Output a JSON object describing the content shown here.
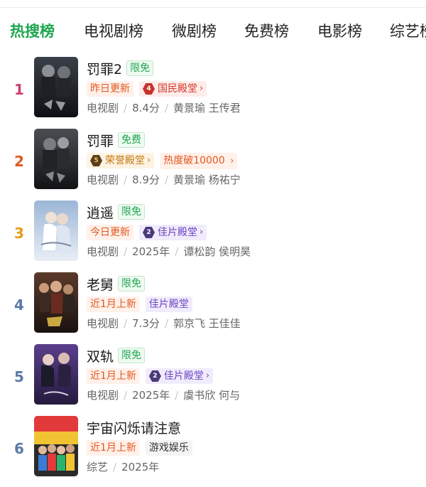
{
  "tabs": [
    {
      "label": "热搜榜",
      "active": true
    },
    {
      "label": "电视剧榜",
      "active": false
    },
    {
      "label": "微剧榜",
      "active": false
    },
    {
      "label": "免费榜",
      "active": false
    },
    {
      "label": "电影榜",
      "active": false
    },
    {
      "label": "综艺榜",
      "active": false
    }
  ],
  "colors": {
    "accent": "#1ea650",
    "rank1": "#d23c6b",
    "rank2": "#e2571f",
    "rank3": "#e99a1a",
    "rank_other": "#5a7aa6"
  },
  "items": [
    {
      "rank": "1",
      "title": "罚罪2",
      "free_badge": "限免",
      "update": "昨日更新",
      "hall_icon": "4",
      "hall": "国民殿堂",
      "hall_chevron": "›",
      "genre": "电视剧",
      "score_or_year": "8.4分",
      "cast": "黄景瑜 王传君"
    },
    {
      "rank": "2",
      "title": "罚罪",
      "free_badge": "免费",
      "hall_icon": "5",
      "hall": "荣誉殿堂",
      "hall_chevron": "›",
      "heat": "热度破10000",
      "heat_chevron": "›",
      "genre": "电视剧",
      "score_or_year": "8.9分",
      "cast": "黄景瑜 杨祐宁"
    },
    {
      "rank": "3",
      "title": "逍遥",
      "free_badge": "限免",
      "update": "今日更新",
      "hall_icon": "2",
      "hall": "佳片殿堂",
      "hall_chevron": "›",
      "genre": "电视剧",
      "score_or_year": "2025年",
      "cast": "谭松韵 侯明昊"
    },
    {
      "rank": "4",
      "title": "老舅",
      "free_badge": "限免",
      "update": "近1月上新",
      "hall": "佳片殿堂",
      "genre": "电视剧",
      "score_or_year": "7.3分",
      "cast": "郭京飞 王佳佳"
    },
    {
      "rank": "5",
      "title": "双轨",
      "free_badge": "限免",
      "update": "近1月上新",
      "hall_icon": "2",
      "hall": "佳片殿堂",
      "hall_chevron": "›",
      "genre": "电视剧",
      "score_or_year": "2025年",
      "cast": "虞书欣 何与"
    },
    {
      "rank": "6",
      "title": "宇宙闪烁请注意",
      "update": "近1月上新",
      "category_tag": "游戏娱乐",
      "genre": "综艺",
      "score_or_year": "2025年"
    }
  ]
}
